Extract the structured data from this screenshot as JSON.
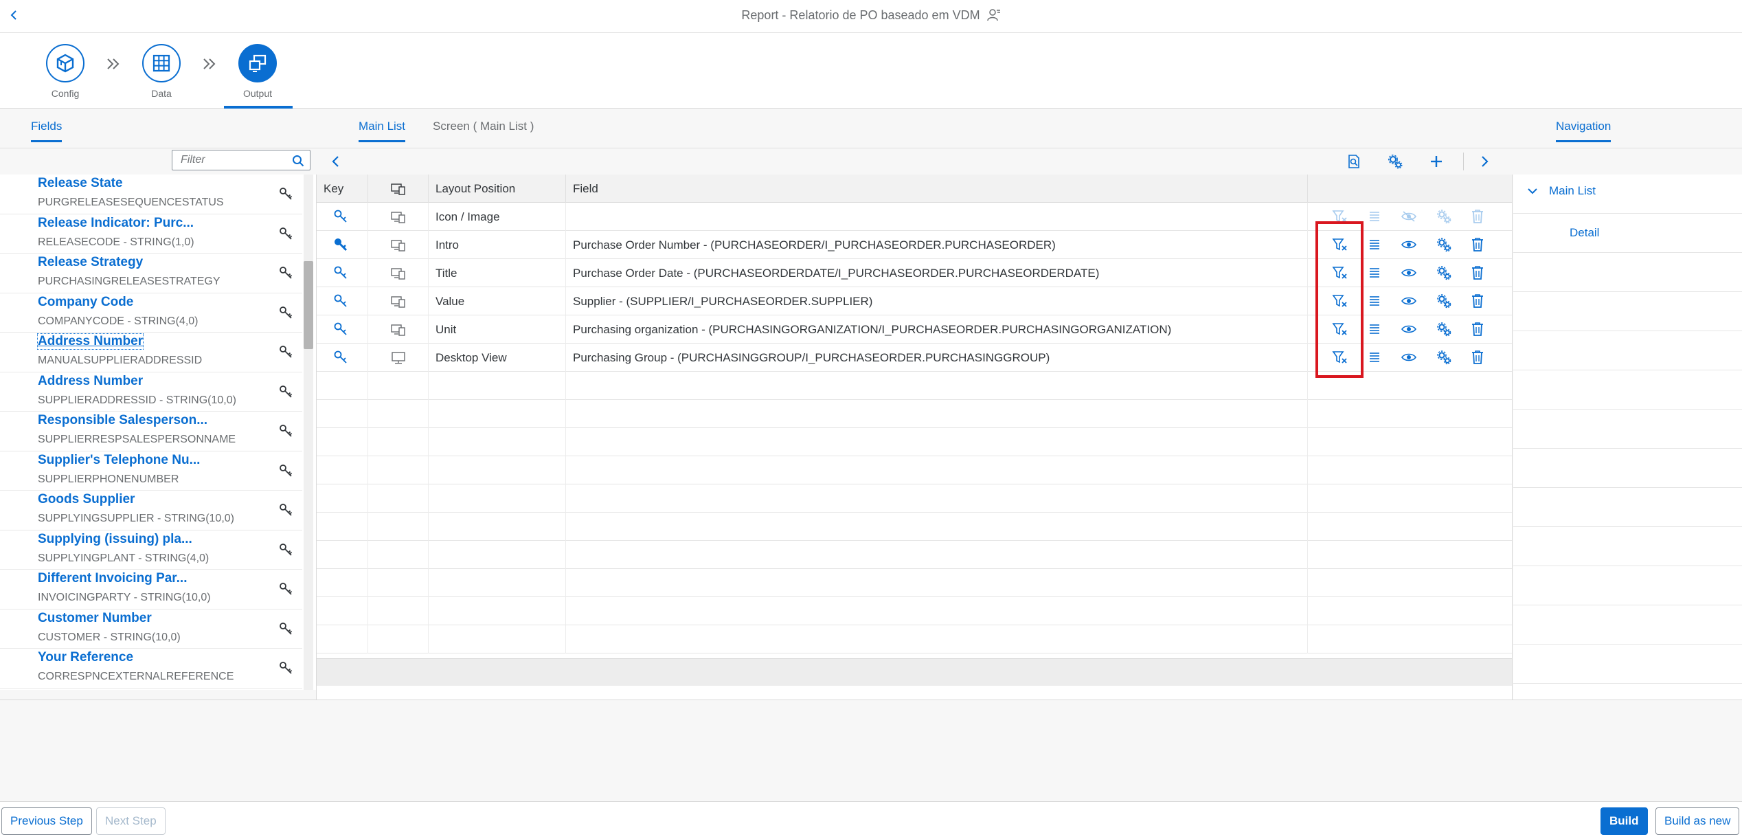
{
  "header": {
    "title": "Report - Relatorio de PO baseado em VDM"
  },
  "wizard": {
    "steps": [
      {
        "label": "Config",
        "icon": "cube-icon"
      },
      {
        "label": "Data",
        "icon": "grid-icon"
      },
      {
        "label": "Output",
        "icon": "output-icon",
        "active": true
      }
    ]
  },
  "tabs": {
    "fields": "Fields",
    "main_list": "Main List",
    "screen": "Screen ( Main List )",
    "navigation": "Navigation"
  },
  "filter": {
    "placeholder": "Filter",
    "value": ""
  },
  "fields": [
    {
      "name": "Release State",
      "tech": "PURGRELEASESEQUENCESTATUS"
    },
    {
      "name": "Release Indicator: Purc...",
      "tech": "RELEASECODE - STRING(1,0)"
    },
    {
      "name": "Release Strategy",
      "tech": "PURCHASINGRELEASESTRATEGY"
    },
    {
      "name": "Company Code",
      "tech": "COMPANYCODE - STRING(4,0)"
    },
    {
      "name": "Address Number",
      "tech": "MANUALSUPPLIERADDRESSID"
    },
    {
      "name": "Address Number",
      "tech": "SUPPLIERADDRESSID - STRING(10,0)"
    },
    {
      "name": "Responsible Salesperson...",
      "tech": "SUPPLIERRESPSALESPERSONNAME"
    },
    {
      "name": "Supplier's Telephone Nu...",
      "tech": "SUPPLIERPHONENUMBER"
    },
    {
      "name": "Goods Supplier",
      "tech": "SUPPLYINGSUPPLIER - STRING(10,0)"
    },
    {
      "name": "Supplying (issuing) pla...",
      "tech": "SUPPLYINGPLANT - STRING(4,0)"
    },
    {
      "name": "Different Invoicing Par...",
      "tech": "INVOICINGPARTY - STRING(10,0)"
    },
    {
      "name": "Customer Number",
      "tech": "CUSTOMER - STRING(10,0)"
    },
    {
      "name": "Your Reference",
      "tech": "CORRESPNCEXTERNALREFERENCE"
    }
  ],
  "table": {
    "columns": {
      "key": "Key",
      "layout_position": "Layout Position",
      "field": "Field"
    },
    "rows": [
      {
        "layout": "Icon / Image",
        "field": "",
        "key_active": false,
        "device": "desktop-mobile-icon",
        "actions_enabled": false
      },
      {
        "layout": "Intro",
        "field": "Purchase Order Number - (PURCHASEORDER/I_PURCHASEORDER.PURCHASEORDER)",
        "key_active": true,
        "device": "desktop-mobile-icon",
        "actions_enabled": true
      },
      {
        "layout": "Title",
        "field": "Purchase Order Date - (PURCHASEORDERDATE/I_PURCHASEORDER.PURCHASEORDERDATE)",
        "key_active": false,
        "device": "desktop-mobile-icon",
        "actions_enabled": true
      },
      {
        "layout": "Value",
        "field": "Supplier - (SUPPLIER/I_PURCHASEORDER.SUPPLIER)",
        "key_active": false,
        "device": "desktop-mobile-icon",
        "actions_enabled": true
      },
      {
        "layout": "Unit",
        "field": "Purchasing organization - (PURCHASINGORGANIZATION/I_PURCHASEORDER.PURCHASINGORGANIZATION)",
        "key_active": false,
        "device": "desktop-mobile-icon",
        "actions_enabled": true
      },
      {
        "layout": "Desktop View",
        "field": "Purchasing Group - (PURCHASINGGROUP/I_PURCHASEORDER.PURCHASINGGROUP)",
        "key_active": false,
        "device": "monitor-icon",
        "actions_enabled": true
      }
    ],
    "empty_rows": 10
  },
  "navigation": {
    "main_list": "Main List",
    "detail": "Detail"
  },
  "footer": {
    "previous": "Previous Step",
    "next": "Next Step",
    "build": "Build",
    "build_as_new": "Build as new"
  },
  "colors": {
    "accent": "#0a6ed1",
    "highlight": "#d9171f"
  }
}
